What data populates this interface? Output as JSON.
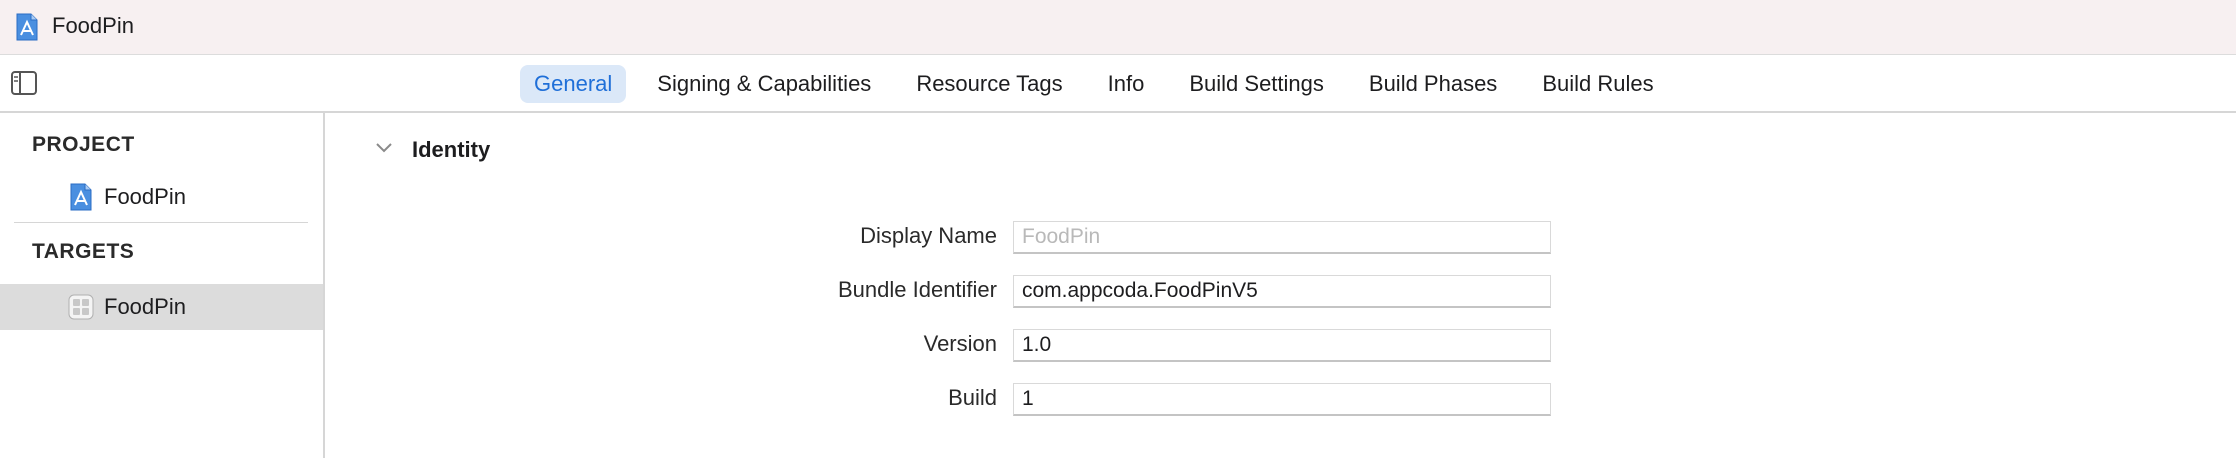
{
  "window": {
    "title": "FoodPin",
    "icon": "xcode-project-icon"
  },
  "toolbar": {
    "sidebar_toggle_icon": "sidebar-toggle-icon",
    "tabs": [
      {
        "label": "General",
        "active": true
      },
      {
        "label": "Signing & Capabilities",
        "active": false
      },
      {
        "label": "Resource Tags",
        "active": false
      },
      {
        "label": "Info",
        "active": false
      },
      {
        "label": "Build Settings",
        "active": false
      },
      {
        "label": "Build Phases",
        "active": false
      },
      {
        "label": "Build Rules",
        "active": false
      }
    ]
  },
  "sidebar": {
    "project_header": "PROJECT",
    "project_item": {
      "label": "FoodPin",
      "icon": "xcode-project-icon"
    },
    "targets_header": "TARGETS",
    "target_item": {
      "label": "FoodPin",
      "icon": "app-target-icon",
      "selected": true
    }
  },
  "identity": {
    "title": "Identity",
    "display_name": {
      "label": "Display Name",
      "value": "",
      "placeholder": "FoodPin"
    },
    "bundle_identifier": {
      "label": "Bundle Identifier",
      "value": "com.appcoda.FoodPinV5"
    },
    "version": {
      "label": "Version",
      "value": "1.0"
    },
    "build": {
      "label": "Build",
      "value": "1"
    }
  },
  "colors": {
    "accent": "#1f6fd8",
    "active_tab_bg": "#dbe8f8",
    "selected_row_bg": "#dcdcdc",
    "titlebar_bg": "#f7f0f1"
  }
}
